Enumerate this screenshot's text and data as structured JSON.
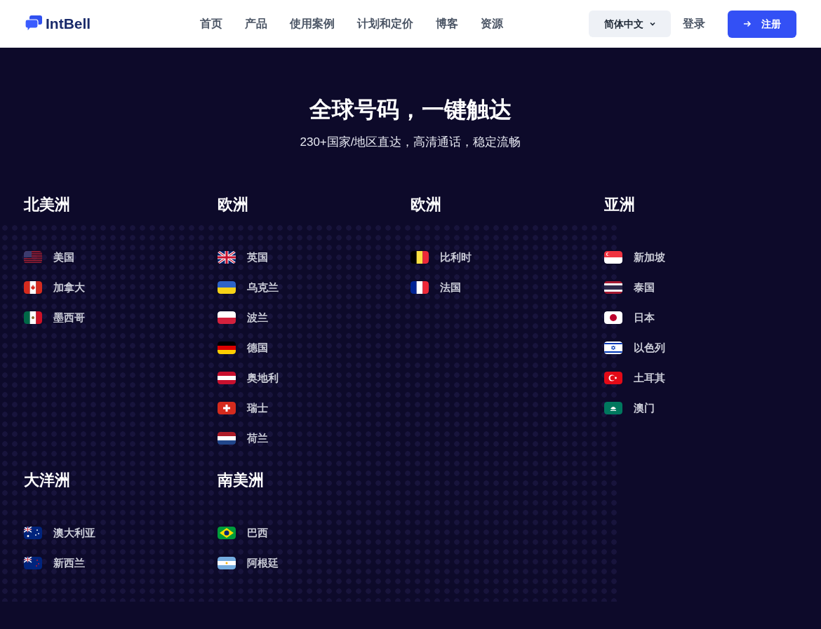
{
  "header": {
    "logo": "IntBell",
    "nav": [
      {
        "label": "首页"
      },
      {
        "label": "产品"
      },
      {
        "label": "使用案例"
      },
      {
        "label": "计划和定价"
      },
      {
        "label": "博客"
      },
      {
        "label": "资源"
      }
    ],
    "language": "简体中文",
    "login": "登录",
    "register": "注册"
  },
  "hero": {
    "title": "全球号码，一键触达",
    "subtitle": "230+国家/地区直达，高清通话，稳定流畅"
  },
  "regions": [
    {
      "name": "北美洲",
      "countries": [
        {
          "name": "美国",
          "kind": "us"
        },
        {
          "name": "加拿大",
          "kind": "ca"
        },
        {
          "name": "墨西哥",
          "kind": "mx"
        }
      ]
    },
    {
      "name": "欧洲",
      "countries": [
        {
          "name": "英国",
          "kind": "gb"
        },
        {
          "name": "乌克兰",
          "kind": "ua"
        },
        {
          "name": "波兰",
          "kind": "pl"
        },
        {
          "name": "德国",
          "kind": "de"
        },
        {
          "name": "奥地利",
          "kind": "at"
        },
        {
          "name": "瑞士",
          "kind": "ch"
        },
        {
          "name": "荷兰",
          "kind": "nl"
        }
      ]
    },
    {
      "name": "欧洲",
      "countries": [
        {
          "name": "比利时",
          "kind": "be"
        },
        {
          "name": "法国",
          "kind": "fr"
        }
      ]
    },
    {
      "name": "亚洲",
      "countries": [
        {
          "name": "新加坡",
          "kind": "sg"
        },
        {
          "name": "泰国",
          "kind": "th"
        },
        {
          "name": "日本",
          "kind": "jp"
        },
        {
          "name": "以色列",
          "kind": "il"
        },
        {
          "name": "土耳其",
          "kind": "tr"
        },
        {
          "name": "澳门",
          "kind": "mo"
        }
      ]
    },
    {
      "name": "大洋洲",
      "countries": [
        {
          "name": "澳大利亚",
          "kind": "au"
        },
        {
          "name": "新西兰",
          "kind": "nz"
        }
      ]
    },
    {
      "name": "南美洲",
      "countries": [
        {
          "name": "巴西",
          "kind": "br"
        },
        {
          "name": "阿根廷",
          "kind": "ar"
        }
      ]
    }
  ]
}
